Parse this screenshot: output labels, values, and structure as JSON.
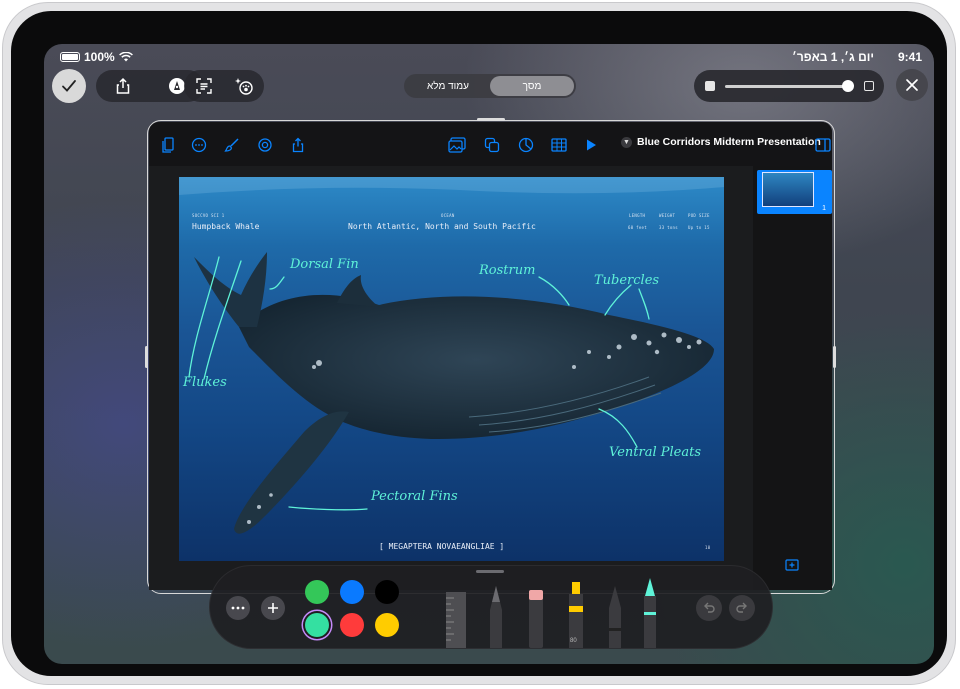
{
  "status": {
    "battery": "100%",
    "date": "יום ג׳, 1 באפר׳",
    "time": "9:41"
  },
  "segments": [
    {
      "label": "עמוד מלא"
    },
    {
      "label": "מסך"
    }
  ],
  "document": {
    "title": "Blue Corridors Midterm Presentation"
  },
  "slide": {
    "meta_left_small": "SOCCVO SCI 1",
    "meta_left": "Humpback Whale",
    "meta_center_small": "OCEAN",
    "meta_center": "North Atlantic, North and South Pacific",
    "meta_right": [
      {
        "head": "LENGTH",
        "val": "60 feet"
      },
      {
        "head": "WEIGHT",
        "val": "33 tons"
      },
      {
        "head": "POD SIZE",
        "val": "Up to 15"
      }
    ],
    "annotations": {
      "dorsal": "Dorsal Fin",
      "rostrum": "Rostrum",
      "tubercles": "Tubercles",
      "flukes": "Flukes",
      "ventral": "Ventral Pleats",
      "pectoral": "Pectoral Fins"
    },
    "scientific_name": "[ MEGAPTERA NOVAEANGLIAE ]",
    "page_number": "10"
  },
  "navigator": {
    "slide_number": "1"
  },
  "palette": {
    "colors": [
      "#34c759",
      "#0a7aff",
      "#000000",
      "#34e0a1",
      "#ff3b3b",
      "#ffcc00"
    ],
    "marker_number": "80"
  },
  "accent": "#0a84ff",
  "ink": "#5ff3d8"
}
